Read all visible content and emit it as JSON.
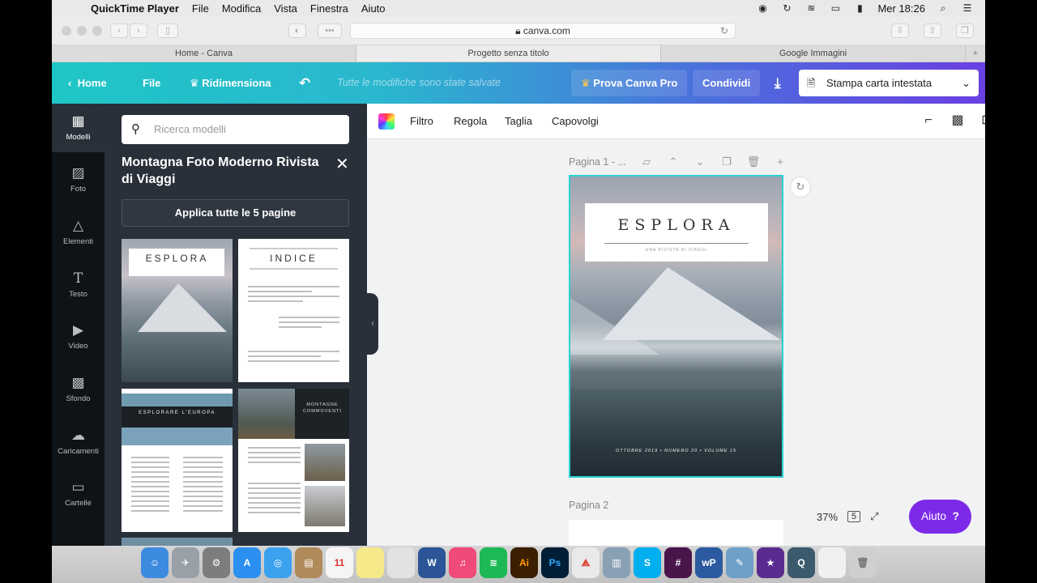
{
  "menubar": {
    "app_name": "QuickTime Player",
    "menus": [
      "File",
      "Modifica",
      "Vista",
      "Finestra",
      "Aiuto"
    ],
    "clock": "Mer 18:26"
  },
  "browser": {
    "url": "canva.com",
    "tabs": [
      "Home - Canva",
      "Progetto senza titolo",
      "Google Immagini"
    ],
    "add_tab": "+"
  },
  "header": {
    "home": "Home",
    "file": "File",
    "resize": "Ridimensiona",
    "saved_status": "Tutte le modifiche sono state salvate",
    "try_pro": "Prova Canva Pro",
    "share": "Condividi",
    "print_label": "Stampa carta intestata"
  },
  "rail": {
    "items": [
      {
        "label": "Modelli",
        "icon": "template-icon"
      },
      {
        "label": "Foto",
        "icon": "photo-icon"
      },
      {
        "label": "Elementi",
        "icon": "elements-icon"
      },
      {
        "label": "Testo",
        "icon": "text-icon"
      },
      {
        "label": "Video",
        "icon": "video-icon"
      },
      {
        "label": "Sfondo",
        "icon": "background-icon"
      },
      {
        "label": "Caricamenti",
        "icon": "upload-icon"
      },
      {
        "label": "Cartelle",
        "icon": "folder-icon"
      }
    ]
  },
  "panel": {
    "search_placeholder": "Ricerca modelli",
    "title": "Montagna Foto Moderno Rivista di Viaggi",
    "apply_button": "Applica tutte le 5 pagine",
    "thumb1_title": "ESPLORA",
    "thumb2_title": "INDICE",
    "thumb3_title": "ESPLORARE L'EUROPA",
    "thumb4_title": "MONTAGNE COMMOVENTI"
  },
  "toolbar": {
    "filter": "Filtro",
    "adjust": "Regola",
    "crop": "Taglia",
    "flip": "Capovolgi"
  },
  "canvas": {
    "page1_label": "Pagina 1 - ...",
    "title": "ESPLORA",
    "subtitle": "UNA RIVISTA DI VIAGGI",
    "footer": "OTTOBRE 2019 • NUMERO 20 • VOLUME 15",
    "page2_label": "Pagina 2",
    "zoom": "37%",
    "page_count": "5",
    "help": "Aiuto",
    "help_mark": "?"
  }
}
